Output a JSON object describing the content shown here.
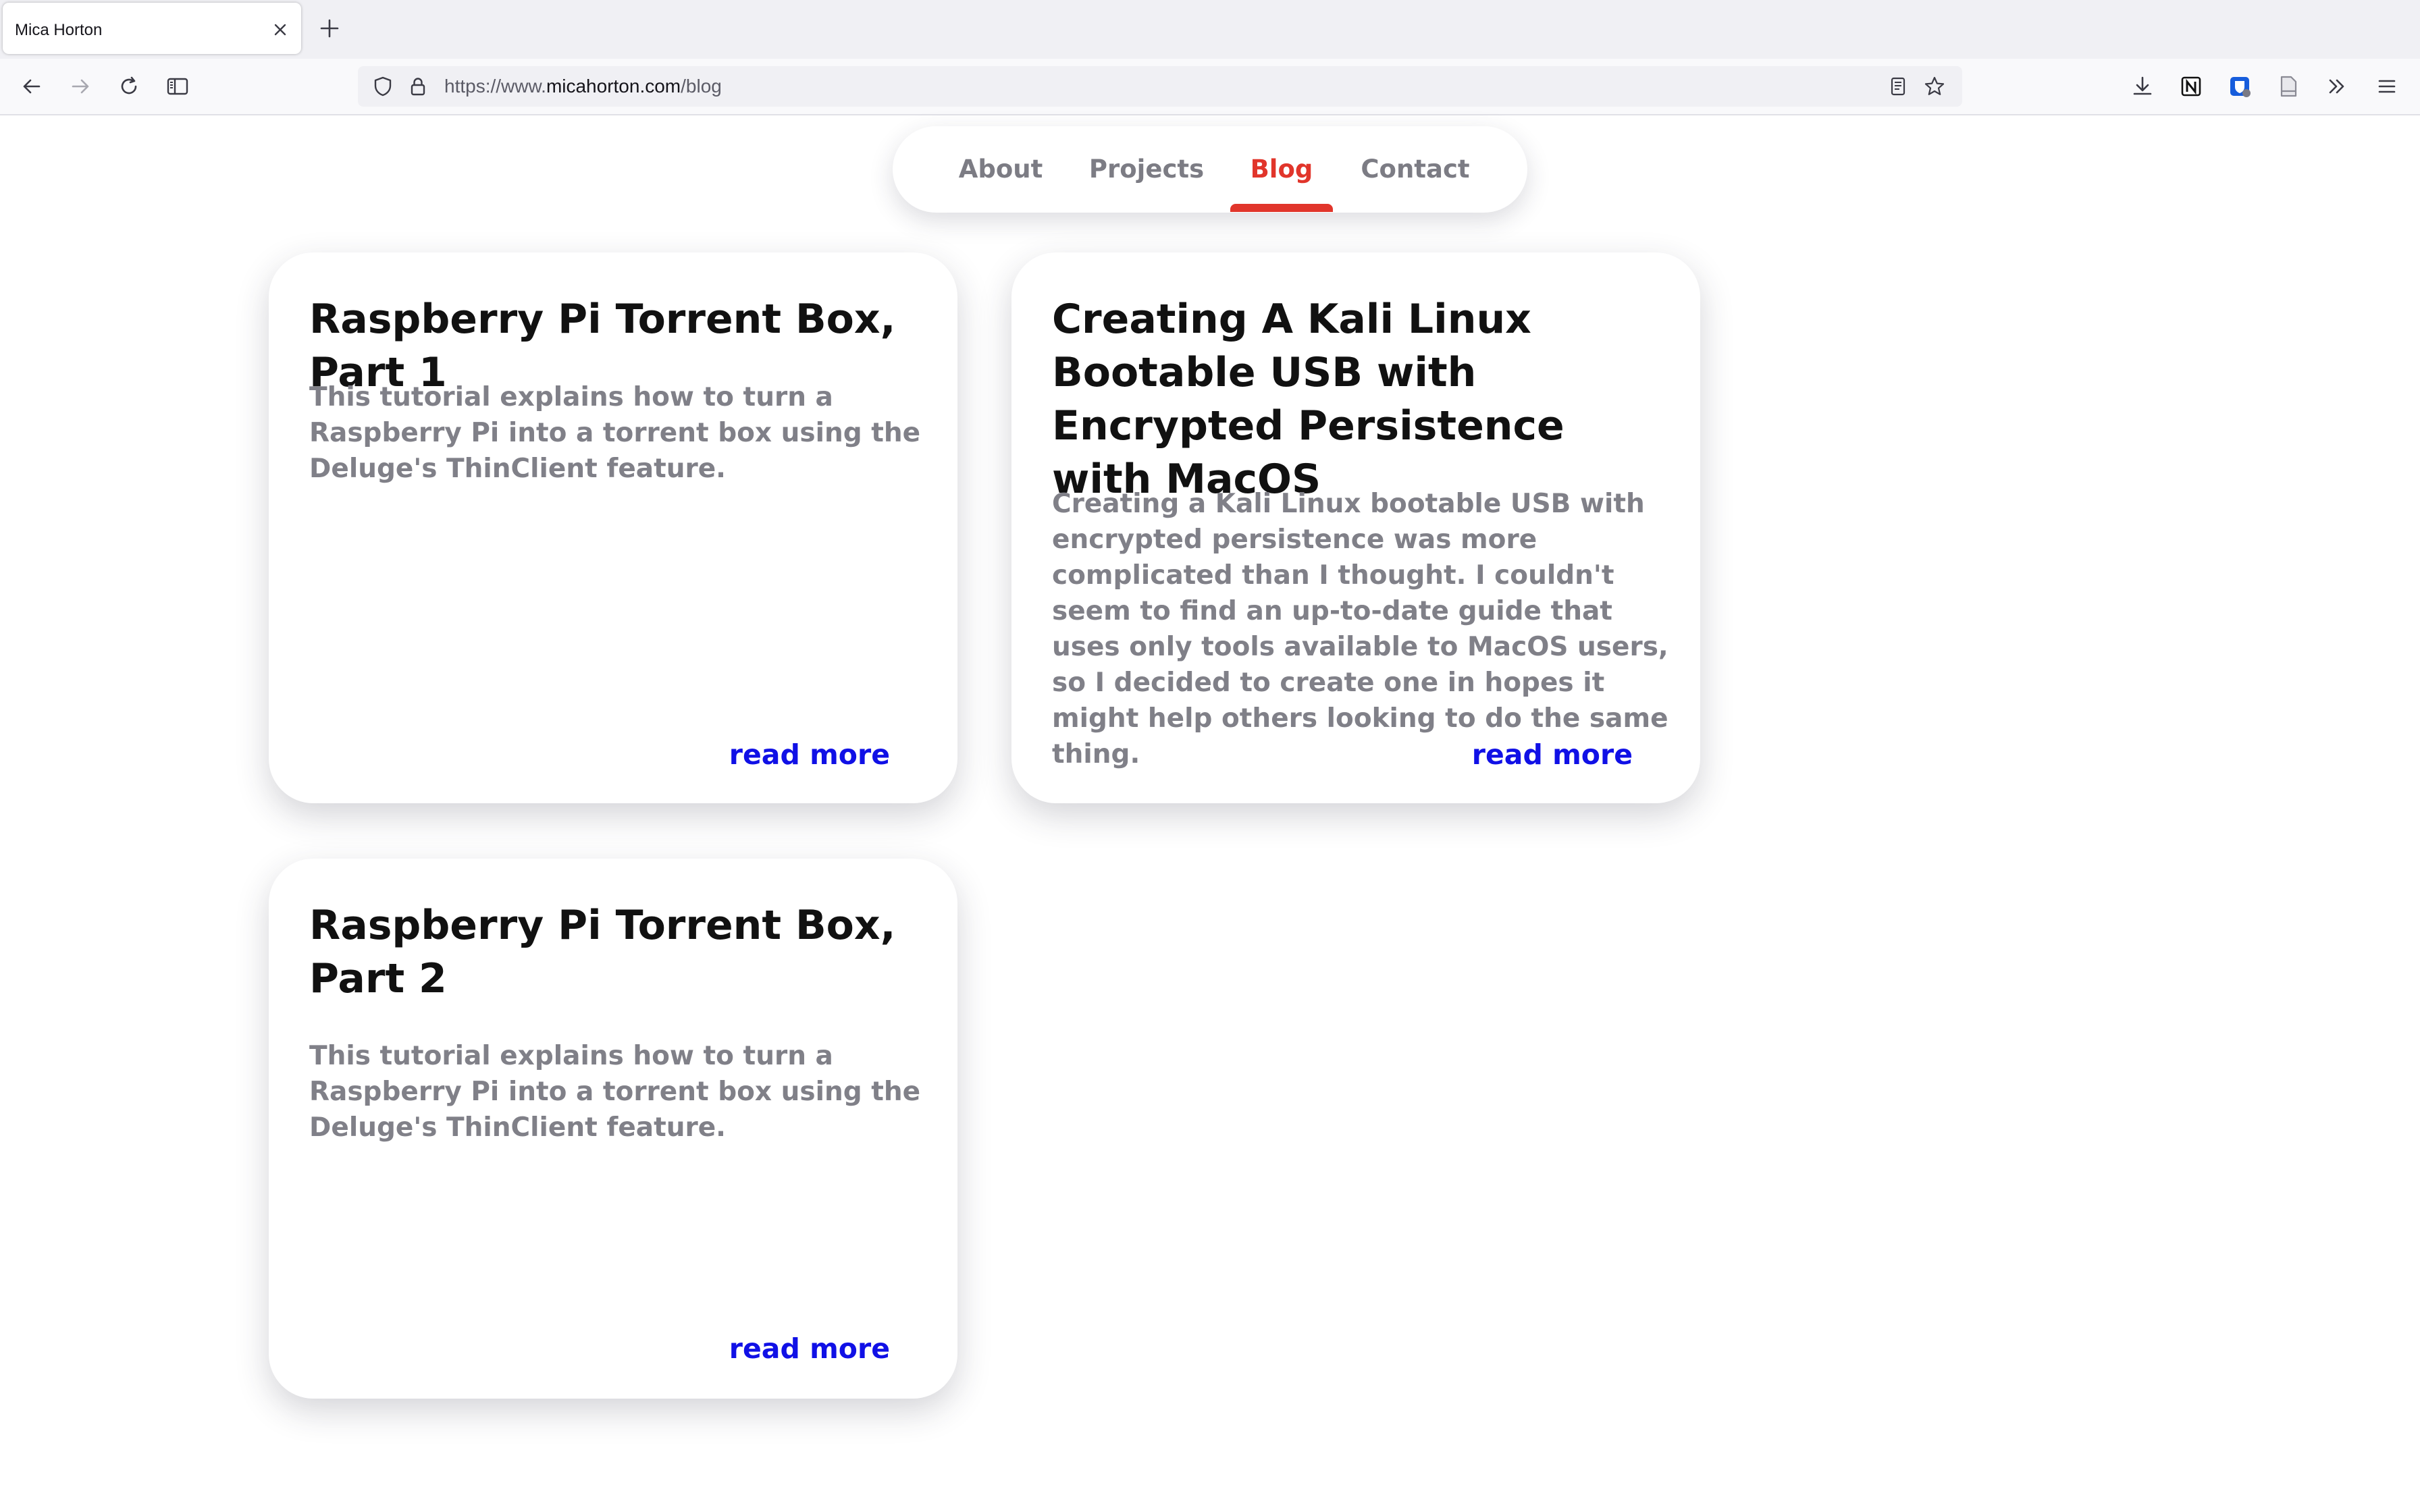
{
  "browser": {
    "tab_title": "Mica Horton",
    "url_prefix": "https://www.",
    "url_host": "micahorton.com",
    "url_path": "/blog",
    "icons": {
      "tab_close": "close-icon",
      "new_tab": "plus-icon",
      "back": "arrow-left-icon",
      "forward": "arrow-right-icon",
      "reload": "reload-icon",
      "sidebar": "sidebar-icon",
      "tracking": "shield-icon",
      "secure": "lock-icon",
      "reader": "reader-view-icon",
      "bookmark": "star-icon",
      "downloads": "download-icon",
      "notion": "notion-extension-icon",
      "bitwarden": "bitwarden-extension-icon",
      "save": "document-icon",
      "overflow": "chevron-double-right-icon",
      "menu": "hamburger-menu-icon"
    }
  },
  "site_nav": {
    "items": [
      {
        "label": "About"
      },
      {
        "label": "Projects"
      },
      {
        "label": "Blog",
        "active": true
      },
      {
        "label": "Contact"
      }
    ],
    "active_color": "#e1352b"
  },
  "posts": [
    {
      "title": "Raspberry Pi Torrent Box, Part 1",
      "excerpt": "This tutorial explains how to turn a Raspberry Pi into a torrent box using the Deluge's ThinClient feature.",
      "link_label": "read more"
    },
    {
      "title": "Creating A Kali Linux Bootable USB with Encrypted Persistence with MacOS",
      "excerpt": "Creating a Kali Linux bootable USB with encrypted persistence was more complicated than I thought. I couldn't seem to find an up-to-date guide that uses only tools available to MacOS users, so I decided to create one in hopes it might help others looking to do the same thing.",
      "link_label": "read more"
    },
    {
      "title": "Raspberry Pi Torrent Box, Part 2",
      "excerpt": "This tutorial explains how to turn a Raspberry Pi into a torrent box using the Deluge's ThinClient feature.",
      "link_label": "read more"
    }
  ],
  "colors": {
    "link": "#1010e6",
    "excerpt": "#808088",
    "title": "#111111"
  }
}
